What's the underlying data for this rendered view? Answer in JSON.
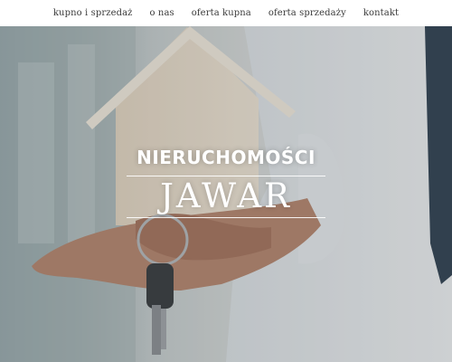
{
  "nav": {
    "items": [
      {
        "label": "kupno i sprzedaż"
      },
      {
        "label": "o nas"
      },
      {
        "label": "oferta kupna"
      },
      {
        "label": "oferta sprzedaży"
      },
      {
        "label": "kontakt"
      }
    ]
  },
  "hero": {
    "title": "NIERUCHOMOŚCI",
    "name": "JAWAR"
  }
}
